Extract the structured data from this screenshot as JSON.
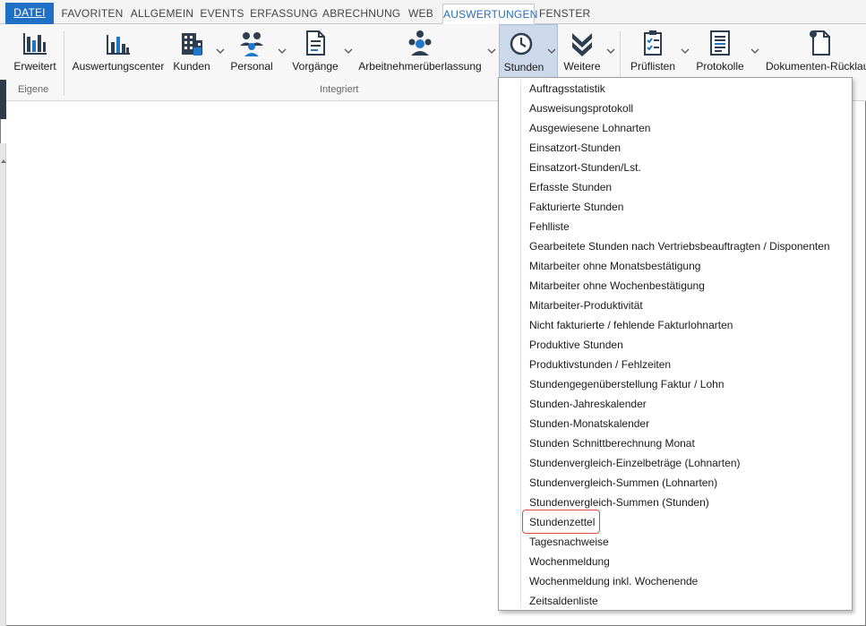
{
  "tabs": [
    {
      "label": "DATEI",
      "state": "file"
    },
    {
      "label": "FAVORITEN",
      "state": "normal"
    },
    {
      "label": "ALLGEMEIN",
      "state": "normal"
    },
    {
      "label": "EVENTS",
      "state": "normal"
    },
    {
      "label": "ERFASSUNG",
      "state": "normal"
    },
    {
      "label": "ABRECHNUNG",
      "state": "normal"
    },
    {
      "label": "WEB",
      "state": "normal"
    },
    {
      "label": "AUSWERTUNGEN",
      "state": "active"
    },
    {
      "label": "FENSTER",
      "state": "normal"
    }
  ],
  "ribbon": {
    "buttons": [
      {
        "label": "Erweitert",
        "icon": "bar-chart-frame-icon"
      },
      {
        "label": "Auswertungscenter",
        "icon": "bar-chart-icon"
      },
      {
        "label": "Kunden",
        "icon": "building-icon"
      },
      {
        "label": "Personal",
        "icon": "people-icon"
      },
      {
        "label": "Vorgänge",
        "icon": "document-icon"
      },
      {
        "label": "Arbeitnehmerüberlassung",
        "icon": "team-icon"
      },
      {
        "label": "Stunden",
        "icon": "clock-icon"
      },
      {
        "label": "Weitere",
        "icon": "double-chevron-down-icon"
      },
      {
        "label": "Prüflisten",
        "icon": "checklist-icon"
      },
      {
        "label": "Protokolle",
        "icon": "list-document-icon"
      },
      {
        "label": "Dokumenten-Rücklauf",
        "icon": "document-return-icon"
      }
    ],
    "groups": {
      "eigene": "Eigene",
      "integriert": "Integriert"
    }
  },
  "stunden_menu": {
    "items": [
      "Auftragsstatistik",
      "Ausweisungsprotokoll",
      "Ausgewiesene Lohnarten",
      "Einsatzort-Stunden",
      "Einsatzort-Stunden/Lst.",
      "Erfasste Stunden",
      "Fakturierte Stunden",
      "Fehlliste",
      "Gearbeitete Stunden nach Vertriebsbeauftragten / Disponenten",
      "Mitarbeiter ohne Monatsbestätigung",
      "Mitarbeiter ohne Wochenbestätigung",
      "Mitarbeiter-Produktivität",
      "Nicht fakturierte / fehlende Fakturlohnarten",
      "Produktive Stunden",
      "Produktivstunden / Fehlzeiten",
      "Stundengegenüberstellung Faktur / Lohn",
      "Stunden-Jahreskalender",
      "Stunden-Monatskalender",
      "Stunden Schnittberechnung Monat",
      "Stundenvergleich-Einzelbeträge (Lohnarten)",
      "Stundenvergleich-Summen (Lohnarten)",
      "Stundenvergleich-Summen (Stunden)",
      "Stundenzettel",
      "Tagesnachweise",
      "Wochenmeldung",
      "Wochenmeldung inkl. Wochenende",
      "Zeitsaldenliste"
    ],
    "highlighted_item": "Stundenzettel"
  },
  "colors": {
    "file_tab": "#1f6fc5",
    "active_tab_text": "#2b6cb8",
    "icon_dark": "#2d3e50",
    "icon_blue": "#1f77c8",
    "highlight_border": "#e04a3c",
    "pressed_button": "#cbd9ea"
  }
}
